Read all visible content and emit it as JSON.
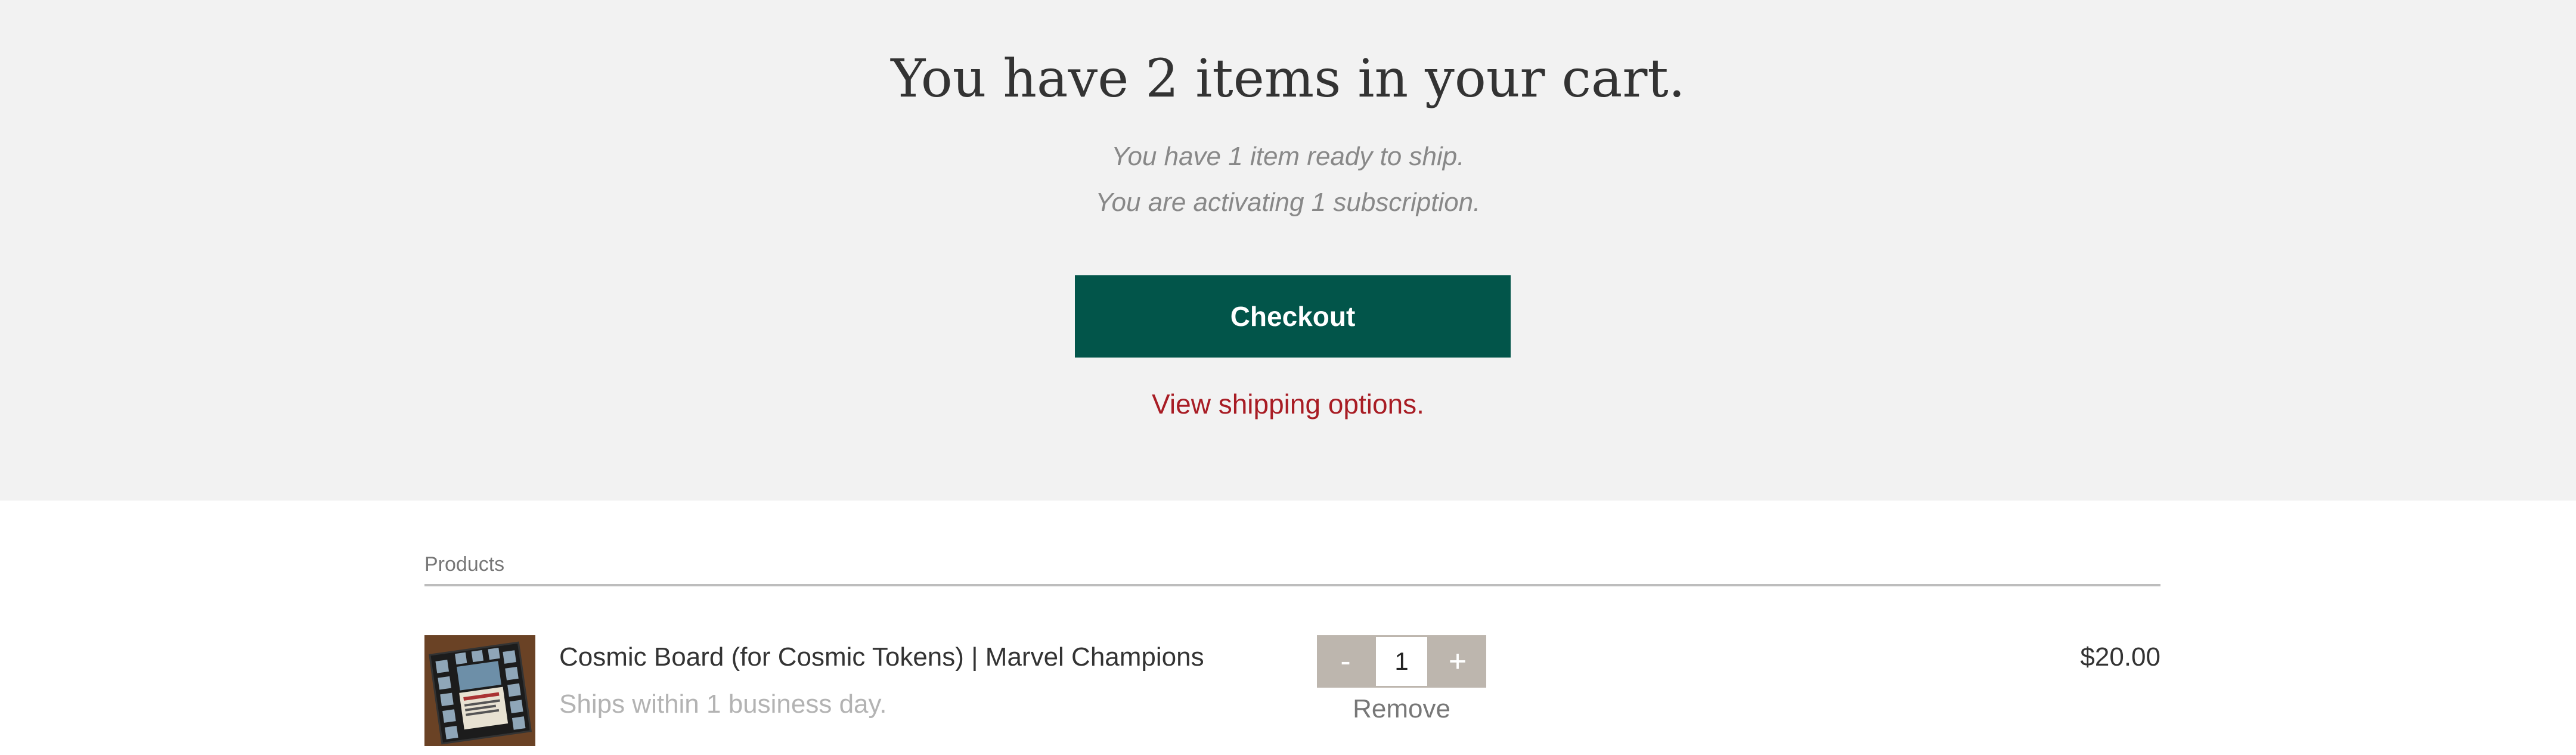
{
  "hero": {
    "title": "You have 2 items in your cart.",
    "ship_line": "You have 1 item ready to ship.",
    "subscription_line": "You are activating 1 subscription.",
    "checkout_label": "Checkout",
    "shipping_link": "View shipping options."
  },
  "products": {
    "header": "Products",
    "items": [
      {
        "name": "Cosmic Board (for Cosmic Tokens) | Marvel Champions",
        "shipping_note": "Ships within 1 business day.",
        "quantity": "1",
        "minus_label": "-",
        "plus_label": "+",
        "remove_label": "Remove",
        "price": "$20.00",
        "thumbnail_icon": "product-board-image"
      }
    ]
  },
  "colors": {
    "hero_bg": "#f2f2f2",
    "checkout_bg": "#02554a",
    "link_red": "#a81c24",
    "stepper_bg": "#bdb6ae"
  }
}
